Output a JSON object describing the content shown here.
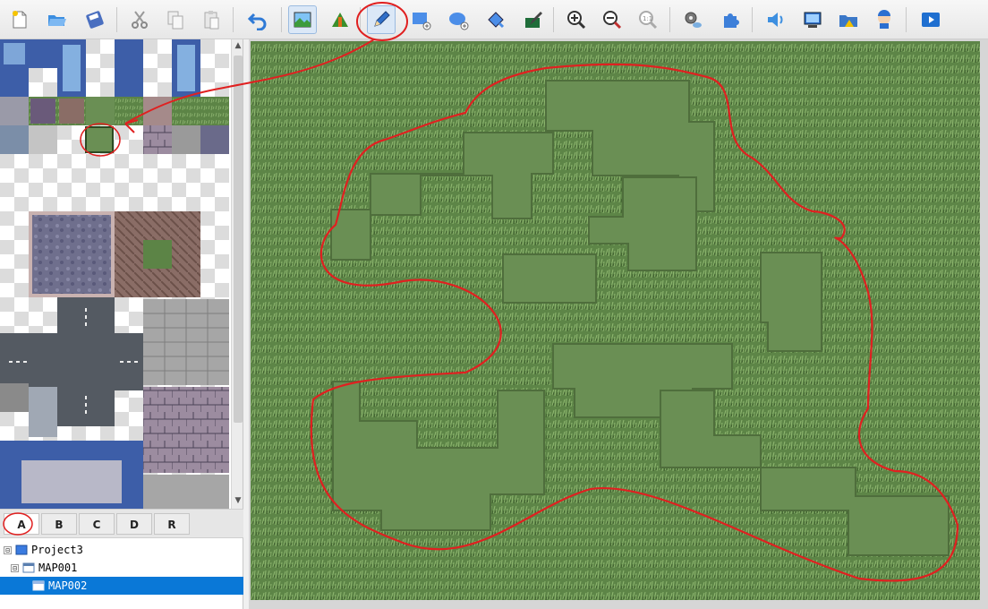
{
  "toolbar": {
    "buttons": [
      {
        "name": "new-project-button",
        "icon": "new-file-icon"
      },
      {
        "name": "open-project-button",
        "icon": "open-folder-icon"
      },
      {
        "name": "save-project-button",
        "icon": "save-icon"
      },
      {
        "name": "cut-button",
        "icon": "scissors-icon"
      },
      {
        "name": "copy-button",
        "icon": "copy-icon"
      },
      {
        "name": "paste-button",
        "icon": "paste-icon"
      },
      {
        "name": "undo-button",
        "icon": "undo-icon"
      },
      {
        "name": "map-mode-button",
        "icon": "map-icon",
        "active": true
      },
      {
        "name": "event-mode-button",
        "icon": "event-icon"
      },
      {
        "name": "pencil-tool-button",
        "icon": "pencil-icon",
        "active": true
      },
      {
        "name": "rectangle-tool-button",
        "icon": "rectangle-icon"
      },
      {
        "name": "ellipse-tool-button",
        "icon": "ellipse-icon"
      },
      {
        "name": "fill-tool-button",
        "icon": "fill-icon"
      },
      {
        "name": "shadow-pen-button",
        "icon": "shadow-pen-icon"
      },
      {
        "name": "zoom-in-button",
        "icon": "zoom-in-icon"
      },
      {
        "name": "zoom-out-button",
        "icon": "zoom-out-icon"
      },
      {
        "name": "zoom-actual-button",
        "icon": "zoom-actual-icon"
      },
      {
        "name": "database-button",
        "icon": "database-icon"
      },
      {
        "name": "plugin-manager-button",
        "icon": "plugin-icon"
      },
      {
        "name": "sound-test-button",
        "icon": "sound-icon"
      },
      {
        "name": "event-searcher-button",
        "icon": "search-window-icon"
      },
      {
        "name": "resource-manager-button",
        "icon": "resource-icon"
      },
      {
        "name": "character-generator-button",
        "icon": "character-icon"
      },
      {
        "name": "playtest-button",
        "icon": "play-icon"
      }
    ]
  },
  "tileset_tabs": [
    "A",
    "B",
    "C",
    "D",
    "R"
  ],
  "active_tab": "A",
  "tree": {
    "items": [
      {
        "label": "Project3",
        "level": 0,
        "toggle": "⊟"
      },
      {
        "label": "MAP001",
        "level": 1,
        "toggle": "⊟"
      },
      {
        "label": "MAP002",
        "level": 2,
        "selected": true
      }
    ]
  },
  "colors": {
    "grass_tile": "#6a8f54",
    "tall_grass": "#5c8446",
    "annotation": "#e02020",
    "selection": "#0a78d7"
  }
}
